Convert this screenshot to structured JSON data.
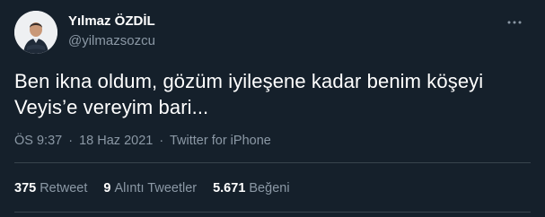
{
  "author": {
    "name": "Yılmaz ÖZDİL",
    "handle": "@yilmazsozcu"
  },
  "tweet": {
    "line1": "Ben ikna oldum, gözüm iyileşene kadar benim köşeyi",
    "line2": "Veyis’e vereyim bari..."
  },
  "meta": {
    "time": "ÖS 9:37",
    "separator1": "·",
    "date": "18 Haz 2021",
    "separator2": "·",
    "source": "Twitter for iPhone"
  },
  "stats": {
    "retweets_count": "375",
    "retweets_label": "Retweet",
    "quotes_count": "9",
    "quotes_label": "Alıntı Tweetler",
    "likes_count": "5.671",
    "likes_label": "Beğeni"
  },
  "icons": {
    "more": "more-horizontal-icon",
    "avatar": "profile-avatar"
  },
  "colors": {
    "background": "#15202b",
    "primary_text": "#ffffff",
    "secondary_text": "#8b98a5",
    "divider": "#38444d"
  }
}
